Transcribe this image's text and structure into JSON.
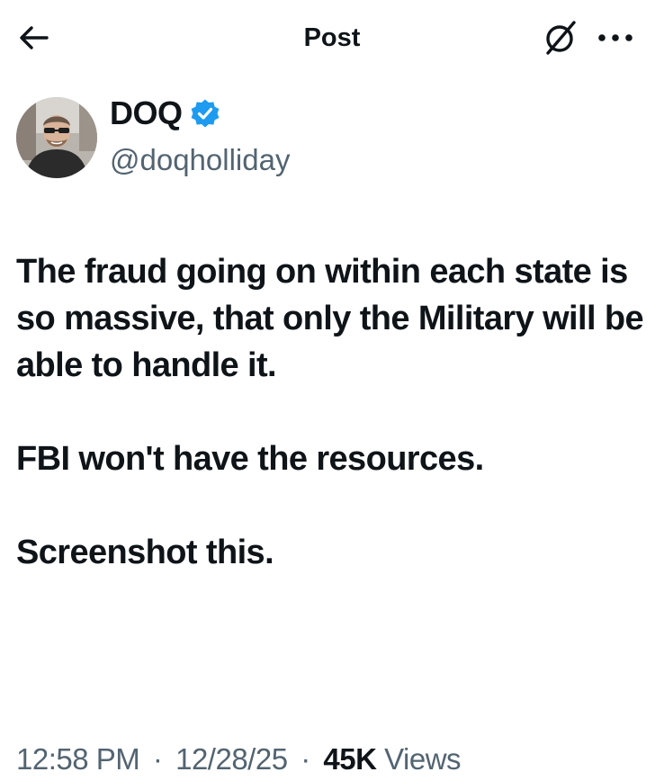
{
  "header": {
    "title": "Post",
    "back_icon": "arrow-left-icon",
    "grok_icon": "grok-slash-icon",
    "more_icon": "more-dots-icon"
  },
  "author": {
    "display_name": "DOQ",
    "handle": "@doqholliday",
    "verified_icon": "verified-badge-icon",
    "verified_color": "#1d9bf0"
  },
  "tweet": {
    "paragraphs": [
      "The fraud going on within each state is so massive, that only the Military will be able to handle it.",
      "FBI won't have the resources.",
      "Screenshot this."
    ]
  },
  "meta": {
    "time": "12:58 PM",
    "date": "12/28/25",
    "separator": "·",
    "views_count": "45K",
    "views_label": "Views"
  },
  "colors": {
    "text_primary": "#0f1419",
    "text_secondary": "#536471",
    "background": "#ffffff"
  }
}
